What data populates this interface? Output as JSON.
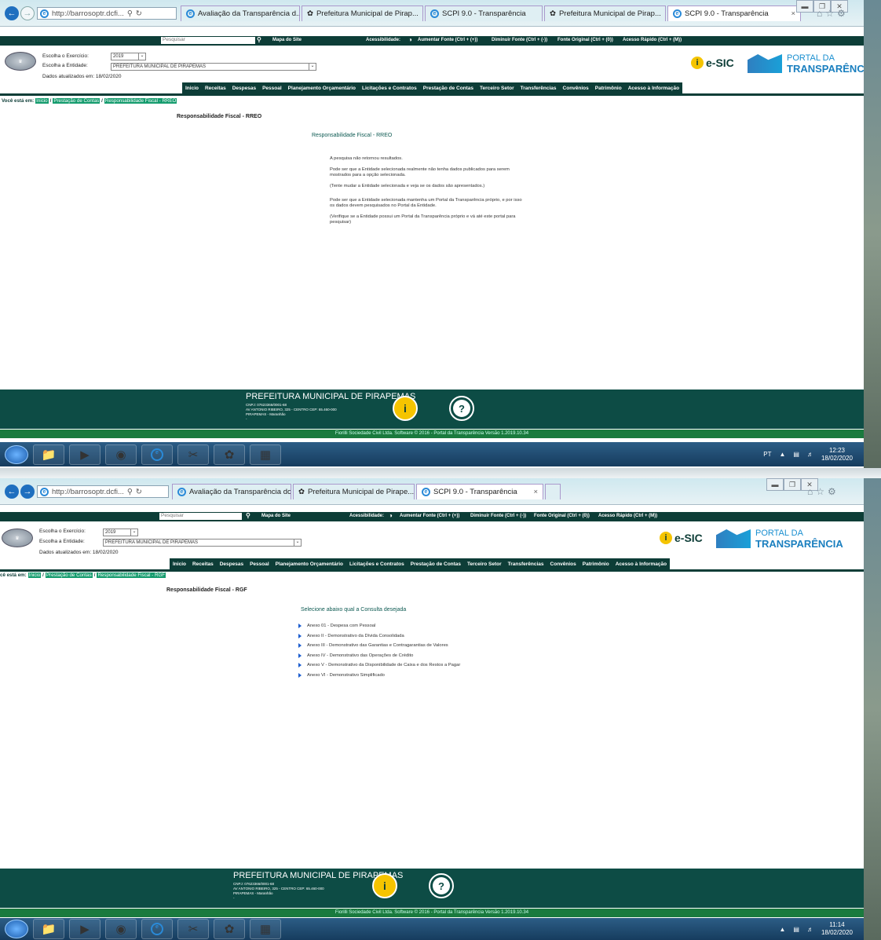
{
  "shot1": {
    "url": "http://barrosoptr.dcfi...",
    "tabs": [
      "Avaliação da Transparência d...",
      "Prefeitura Municipal de Pirap...",
      "SCPI 9.0 - Transparência",
      "Prefeitura Municipal de Pirap...",
      "SCPI 9.0 - Transparência"
    ],
    "exercicio": "2019",
    "entidade": "PREFEITURA MUNICIPAL DE PIRAPEMAS",
    "crumb": [
      "Inicio",
      "Prestação de Contas",
      "Responsabilidade Fiscal - RREO"
    ],
    "page_title": "Responsabilidade Fiscal - RREO",
    "content_title": "Responsabilidade Fiscal - RREO",
    "p1": "A pesquisa não retornou resultados.",
    "p2a": "Pode ser que a Entidade selecionada realmente não tenha dados publicados para serem mostrados para a opção selecionada.",
    "p2b": "(Tente mudar a Entidade selecionada e veja se os dados são apresentados.)",
    "p3a": "Pode ser que a Entidade selecionada mantenha um Portal da Transparência próprio, e por isso os dados devem pesquisados no Portal da Entidade.",
    "p3b": "(Verifique se a Entidade possui um Portal da Transparência próprio e vá até este portal para pesquisar)",
    "time": "12:23",
    "date": "18/02/2020"
  },
  "shot2": {
    "url": "http://barrosoptr.dcfi...",
    "tabs": [
      "Avaliação da Transparência do...",
      "Prefeitura Municipal de Pirape...",
      "SCPI 9.0 - Transparência"
    ],
    "exercicio": "2019",
    "entidade": "PREFEITURA MUNICIPAL DE PIRAPEMAS",
    "crumb": [
      "Inicio",
      "Prestação de Contas",
      "Responsabilidade Fiscal - RGF"
    ],
    "page_title": "Responsabilidade Fiscal - RGF",
    "content_title": "Selecione abaixo qual a Consulta desejada",
    "items": [
      "Anexo 01 - Despesa com Pessoal",
      "Anexo II - Demonstrativo da Dívida Consolidada",
      "Anexo III - Demonstrativo das Garantias e Contragarantias de Valores",
      "Anexo IV - Demonstrativo das Operações de Crédito",
      "Anexo V - Demonstrativo da Disponibilidade de Caixa e dos Restos a Pagar",
      "Anexo VI - Demonstrativo Simplificado"
    ],
    "time": "11:14",
    "date": "18/02/2020"
  },
  "common": {
    "close_tab": "×",
    "pesquisar": "Pesquisar",
    "mapa": "Mapa do Site",
    "acess": "Acessibilidade:",
    "aumentar": "Aumentar Fonte (Ctrl + (+))",
    "diminuir": "Diminuir Fonte (Ctrl + (-))",
    "original": "Fonte Original (Ctrl + (0))",
    "rapido": "Acesso Rápido (Ctrl + (M))",
    "lbl_exercicio": "Escolha o Exercício:",
    "lbl_entidade": "Escolha a Entidade:",
    "atualizados": "Dados atualizados em: 18/02/2020",
    "esic": "e-SIC",
    "portal_a": "PORTAL DA",
    "portal_b": "TRANSPARÊNCIA",
    "menu": [
      "Inicio",
      "Receitas",
      "Despesas",
      "Pessoal",
      "Planejamento Orçamentário",
      "Licitações e Contratos",
      "Prestação de Contas",
      "Terceiro Setor",
      "Transferências",
      "Convênios",
      "Patrimônio",
      "Acesso à Informação"
    ],
    "voce": "Você está em:",
    "voce2": "cê está em:",
    "footer_name": "PREFEITURA MUNICIPAL DE PIRAPEMAS",
    "cnpj": "CNPJ: 07623366/0001-68",
    "endereco": "AV ANTONIO RIBEIRO, 325 - CENTRO CEP: 65.460-000",
    "cidade": "PIRAPEMAS - Maranhão",
    "dash": "-",
    "credit": "Fiorilli Sociedade Civil Ltda. Software © 2016 - Portal da Transparência Versão 1.2019.10.34",
    "lang": "PT"
  },
  "colors": {
    "brand_dark": "#0d3d37",
    "footer": "#0d4c45",
    "breadcrumb": "#159c6e",
    "accent_yellow": "#f5c400"
  }
}
